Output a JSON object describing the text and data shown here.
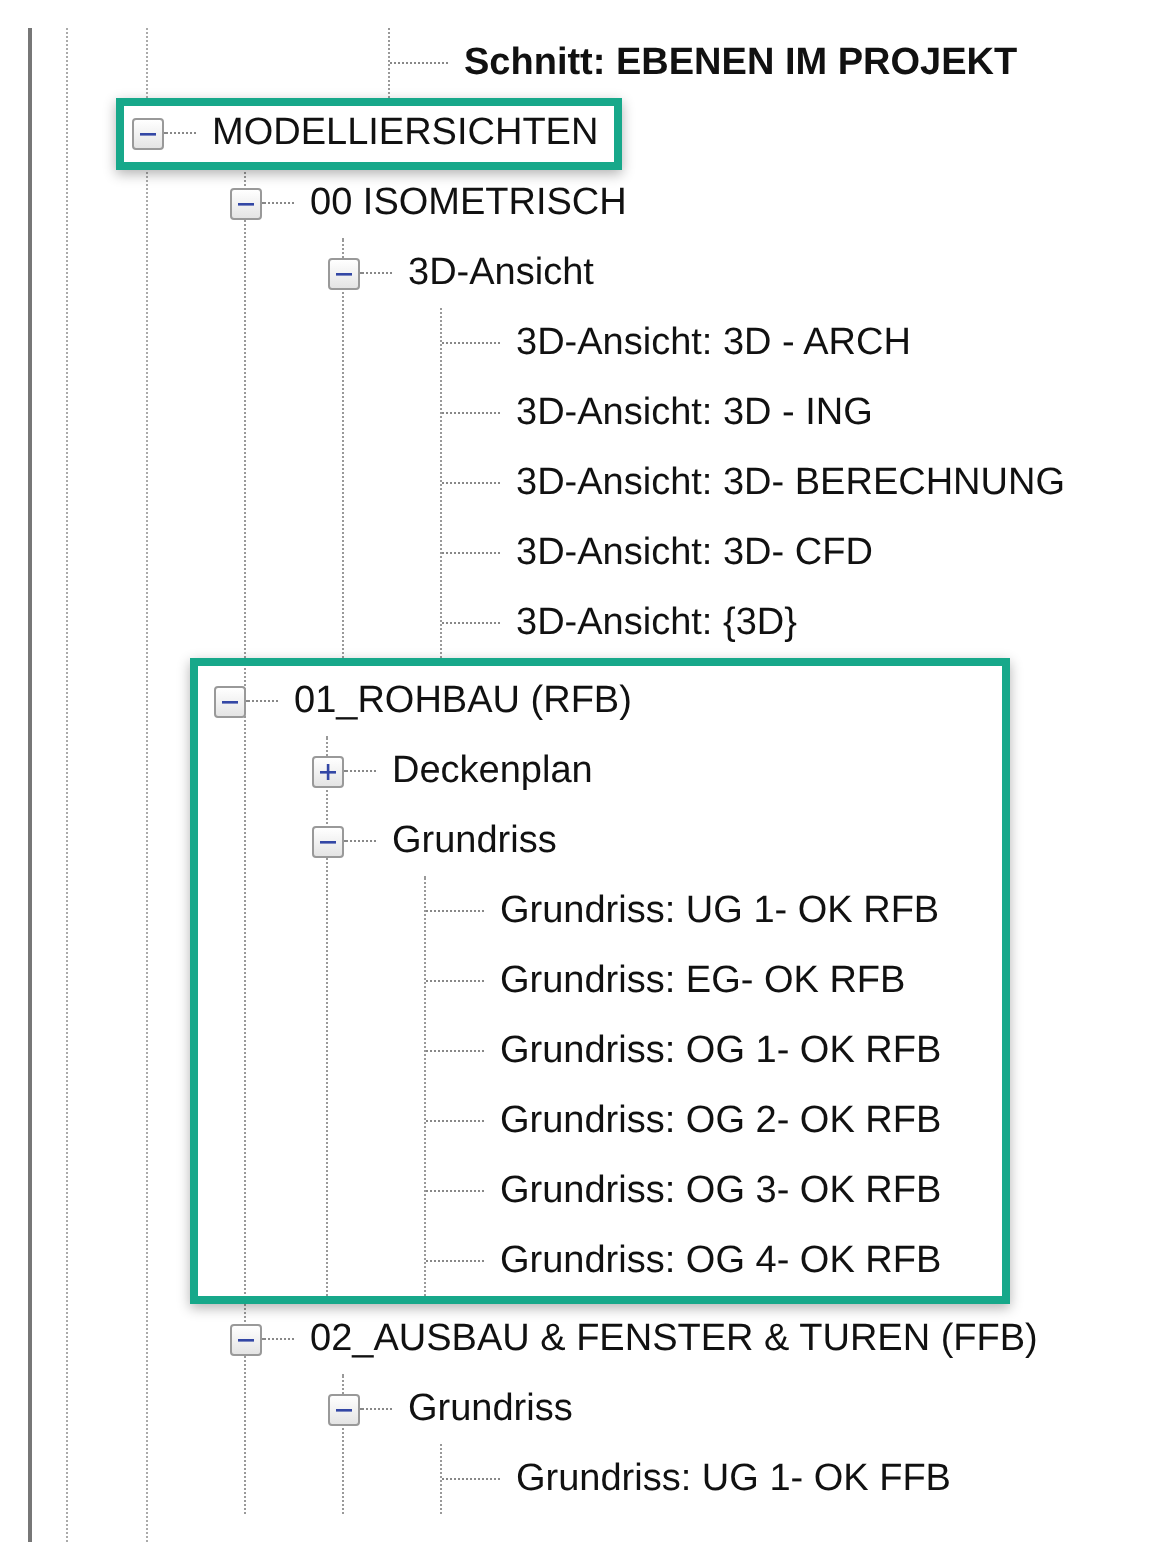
{
  "partial_top_item": {
    "label": "Schnitt: EBENEN IM PROJEKT",
    "bold": true
  },
  "tree": [
    {
      "label": "MODELLIERSICHTEN",
      "expanded": true,
      "row_highlighted": true,
      "children": [
        {
          "label": "00 ISOMETRISCH",
          "expanded": true,
          "children": [
            {
              "label": "3D-Ansicht",
              "expanded": true,
              "children": [
                {
                  "label": "3D-Ansicht: 3D - ARCH"
                },
                {
                  "label": "3D-Ansicht: 3D - ING"
                },
                {
                  "label": "3D-Ansicht: 3D- BERECHNUNG"
                },
                {
                  "label": "3D-Ansicht: 3D- CFD"
                },
                {
                  "label": "3D-Ansicht: {3D}"
                }
              ]
            }
          ]
        },
        {
          "label": "01_ROHBAU (RFB)",
          "expanded": true,
          "group_highlighted": true,
          "children": [
            {
              "label": "Deckenplan",
              "expanded": false
            },
            {
              "label": "Grundriss",
              "expanded": true,
              "children": [
                {
                  "label": "Grundriss: UG 1- OK RFB"
                },
                {
                  "label": "Grundriss: EG- OK RFB"
                },
                {
                  "label": "Grundriss: OG 1- OK RFB"
                },
                {
                  "label": "Grundriss: OG 2- OK RFB"
                },
                {
                  "label": "Grundriss: OG 3- OK RFB"
                },
                {
                  "label": "Grundriss: OG 4- OK RFB"
                }
              ]
            }
          ]
        },
        {
          "label": "02_AUSBAU & FENSTER & TUREN (FFB)",
          "expanded": true,
          "children": [
            {
              "label": "Grundriss",
              "expanded": true,
              "children": [
                {
                  "label": "Grundriss: UG 1- OK FFB"
                }
              ]
            }
          ]
        }
      ]
    }
  ]
}
